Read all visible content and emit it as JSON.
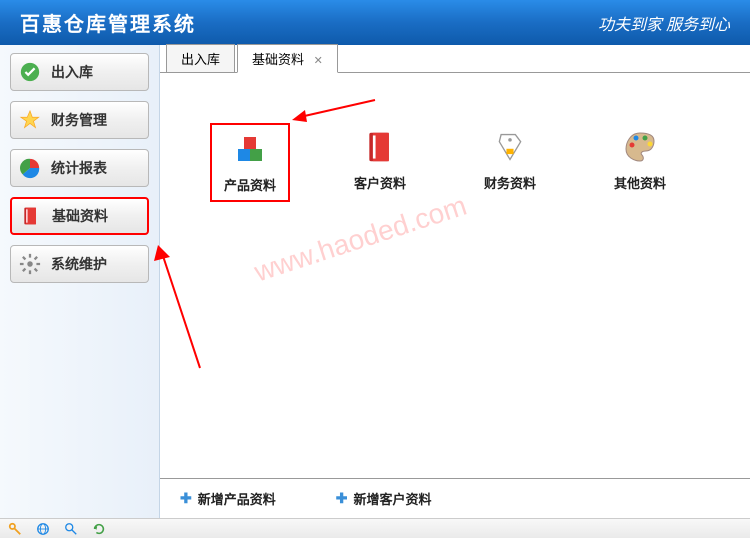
{
  "header": {
    "title": "百惠仓库管理系统",
    "slogan": "功夫到家 服务到心"
  },
  "sidebar": {
    "items": [
      {
        "label": "出入库",
        "icon": "check-circle"
      },
      {
        "label": "财务管理",
        "icon": "star"
      },
      {
        "label": "统计报表",
        "icon": "pie-chart"
      },
      {
        "label": "基础资料",
        "icon": "book"
      },
      {
        "label": "系统维护",
        "icon": "gear"
      }
    ]
  },
  "tabs": [
    {
      "label": "出入库",
      "active": false
    },
    {
      "label": "基础资料",
      "active": true
    }
  ],
  "grid": [
    {
      "label": "产品资料",
      "icon": "boxes"
    },
    {
      "label": "客户资料",
      "icon": "red-book"
    },
    {
      "label": "财务资料",
      "icon": "tag"
    },
    {
      "label": "其他资料",
      "icon": "palette"
    }
  ],
  "bottom_links": [
    {
      "label": "新增产品资料"
    },
    {
      "label": "新增客户资料"
    }
  ],
  "watermark": "www.haoded.com",
  "annotations": {
    "red_highlighted_nav_index": 3,
    "red_highlighted_grid_index": 0
  }
}
